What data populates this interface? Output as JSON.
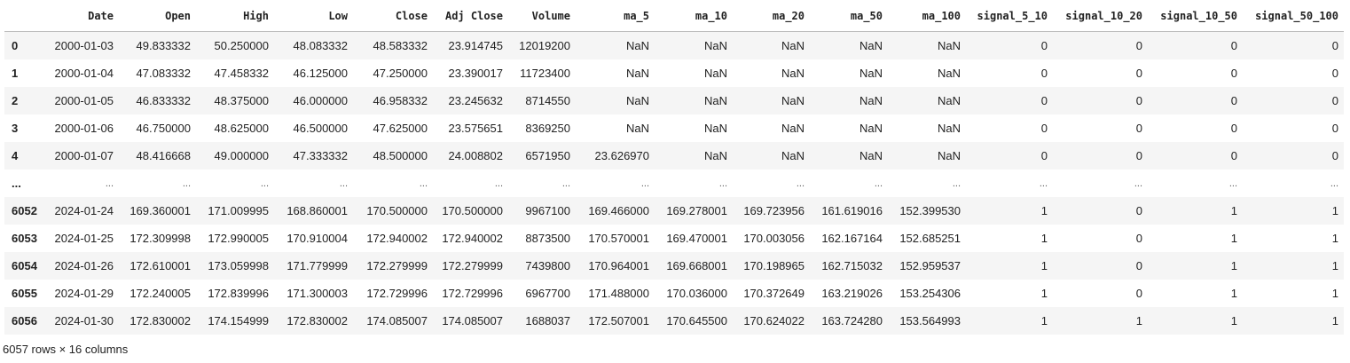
{
  "columns": [
    "Date",
    "Open",
    "High",
    "Low",
    "Close",
    "Adj Close",
    "Volume",
    "ma_5",
    "ma_10",
    "ma_20",
    "ma_50",
    "ma_100",
    "signal_5_10",
    "signal_10_20",
    "signal_10_50",
    "signal_50_100"
  ],
  "rows_head": [
    {
      "index": "0",
      "cells": [
        "2000-01-03",
        "49.833332",
        "50.250000",
        "48.083332",
        "48.583332",
        "23.914745",
        "12019200",
        "NaN",
        "NaN",
        "NaN",
        "NaN",
        "NaN",
        "0",
        "0",
        "0",
        "0"
      ]
    },
    {
      "index": "1",
      "cells": [
        "2000-01-04",
        "47.083332",
        "47.458332",
        "46.125000",
        "47.250000",
        "23.390017",
        "11723400",
        "NaN",
        "NaN",
        "NaN",
        "NaN",
        "NaN",
        "0",
        "0",
        "0",
        "0"
      ]
    },
    {
      "index": "2",
      "cells": [
        "2000-01-05",
        "46.833332",
        "48.375000",
        "46.000000",
        "46.958332",
        "23.245632",
        "8714550",
        "NaN",
        "NaN",
        "NaN",
        "NaN",
        "NaN",
        "0",
        "0",
        "0",
        "0"
      ]
    },
    {
      "index": "3",
      "cells": [
        "2000-01-06",
        "46.750000",
        "48.625000",
        "46.500000",
        "47.625000",
        "23.575651",
        "8369250",
        "NaN",
        "NaN",
        "NaN",
        "NaN",
        "NaN",
        "0",
        "0",
        "0",
        "0"
      ]
    },
    {
      "index": "4",
      "cells": [
        "2000-01-07",
        "48.416668",
        "49.000000",
        "47.333332",
        "48.500000",
        "24.008802",
        "6571950",
        "23.626970",
        "NaN",
        "NaN",
        "NaN",
        "NaN",
        "0",
        "0",
        "0",
        "0"
      ]
    }
  ],
  "ellipsis": "...",
  "rows_tail": [
    {
      "index": "6052",
      "cells": [
        "2024-01-24",
        "169.360001",
        "171.009995",
        "168.860001",
        "170.500000",
        "170.500000",
        "9967100",
        "169.466000",
        "169.278001",
        "169.723956",
        "161.619016",
        "152.399530",
        "1",
        "0",
        "1",
        "1"
      ]
    },
    {
      "index": "6053",
      "cells": [
        "2024-01-25",
        "172.309998",
        "172.990005",
        "170.910004",
        "172.940002",
        "172.940002",
        "8873500",
        "170.570001",
        "169.470001",
        "170.003056",
        "162.167164",
        "152.685251",
        "1",
        "0",
        "1",
        "1"
      ]
    },
    {
      "index": "6054",
      "cells": [
        "2024-01-26",
        "172.610001",
        "173.059998",
        "171.779999",
        "172.279999",
        "172.279999",
        "7439800",
        "170.964001",
        "169.668001",
        "170.198965",
        "162.715032",
        "152.959537",
        "1",
        "0",
        "1",
        "1"
      ]
    },
    {
      "index": "6055",
      "cells": [
        "2024-01-29",
        "172.240005",
        "172.839996",
        "171.300003",
        "172.729996",
        "172.729996",
        "6967700",
        "171.488000",
        "170.036000",
        "170.372649",
        "163.219026",
        "153.254306",
        "1",
        "0",
        "1",
        "1"
      ]
    },
    {
      "index": "6056",
      "cells": [
        "2024-01-30",
        "172.830002",
        "174.154999",
        "172.830002",
        "174.085007",
        "174.085007",
        "1688037",
        "172.507001",
        "170.645500",
        "170.624022",
        "163.724280",
        "153.564993",
        "1",
        "1",
        "1",
        "1"
      ]
    }
  ],
  "footer": "6057 rows × 16 columns"
}
